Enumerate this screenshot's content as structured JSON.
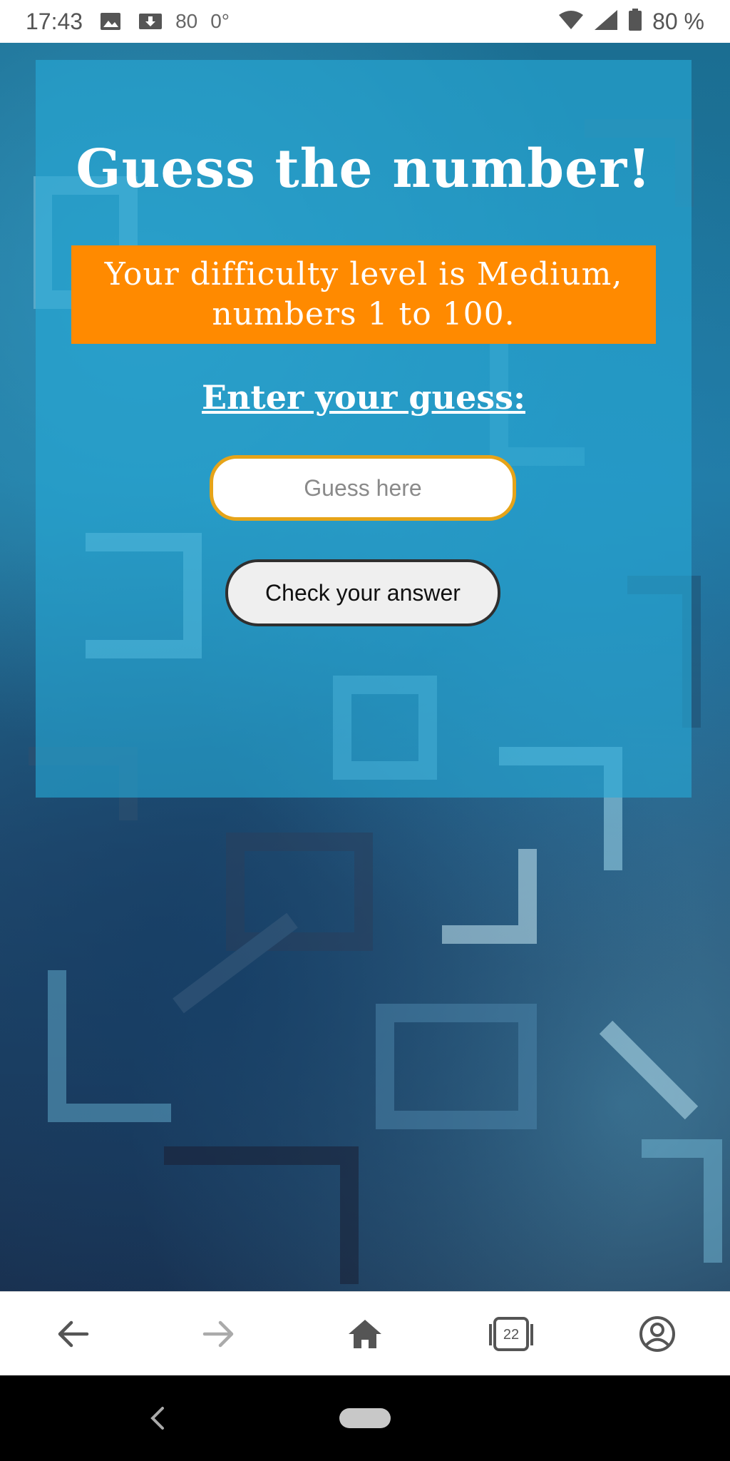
{
  "status_bar": {
    "time": "17:43",
    "notification_count": "80",
    "temperature": "0°",
    "battery_percent": "80 %"
  },
  "game": {
    "title": "Guess the number!",
    "difficulty_message": "Your difficulty level is Medium, numbers 1 to 100.",
    "prompt": "Enter your guess:",
    "input_placeholder": "Guess here",
    "input_value": "",
    "check_button_label": "Check your answer"
  },
  "browser_toolbar": {
    "tab_count": "22",
    "icons": [
      "back-arrow-icon",
      "forward-arrow-icon",
      "home-icon",
      "tabs-icon",
      "account-icon"
    ]
  },
  "colors": {
    "card_bg": "#26aad6",
    "difficulty_bg": "#ff8a00",
    "input_border": "#e6a419",
    "button_bg": "#efefef"
  }
}
